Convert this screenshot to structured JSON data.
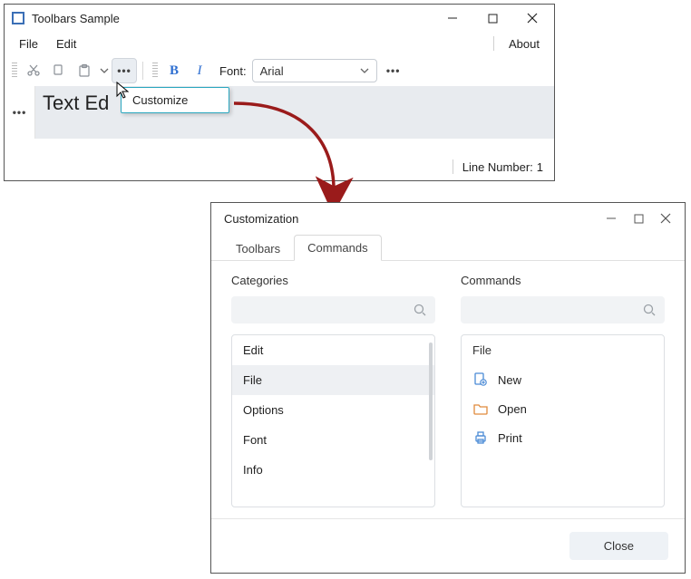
{
  "main": {
    "title": "Toolbars Sample",
    "menus": {
      "file": "File",
      "edit": "Edit",
      "about": "About"
    },
    "toolbar": {
      "font_label": "Font:",
      "font_value": "Arial"
    },
    "doc": {
      "visible_text": "Text Ed"
    },
    "popup": {
      "customize": "Customize"
    },
    "status": {
      "line_number_label": "Line Number:",
      "line_number_value": "1"
    }
  },
  "dialog": {
    "title": "Customization",
    "tabs": {
      "toolbars": "Toolbars",
      "commands": "Commands"
    },
    "categories": {
      "label": "Categories",
      "items": [
        "Edit",
        "File",
        "Options",
        "Font",
        "Info"
      ],
      "selected_index": 1
    },
    "commands": {
      "label": "Commands",
      "group": "File",
      "items": [
        "New",
        "Open",
        "Print"
      ]
    },
    "close": "Close"
  }
}
